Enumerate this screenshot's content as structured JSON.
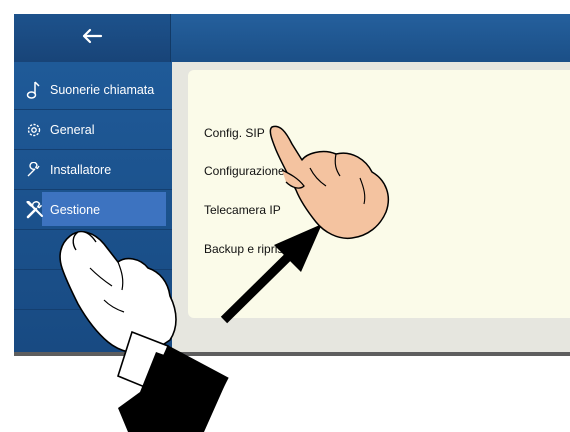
{
  "header": {
    "back_icon": "arrow-left-icon"
  },
  "sidebar": {
    "items": [
      {
        "label": "Suonerie chiamata",
        "icon": "music-note-icon",
        "selected": false
      },
      {
        "label": "General",
        "icon": "gear-icon",
        "selected": false
      },
      {
        "label": "Installatore",
        "icon": "wrench-icon",
        "selected": false
      },
      {
        "label": "Gestione",
        "icon": "tools-icon",
        "selected": true
      }
    ]
  },
  "main": {
    "menu": [
      {
        "label": "Config. SIP"
      },
      {
        "label": "Configurazione"
      },
      {
        "label": "Telecamera IP"
      },
      {
        "label": "Backup e ripristino"
      }
    ]
  },
  "colors": {
    "header_blue": "#1b4f87",
    "sidebar_blue": "#1f5a98",
    "selected_blue": "#3d73c0",
    "content_bg": "#fbfbe9"
  }
}
